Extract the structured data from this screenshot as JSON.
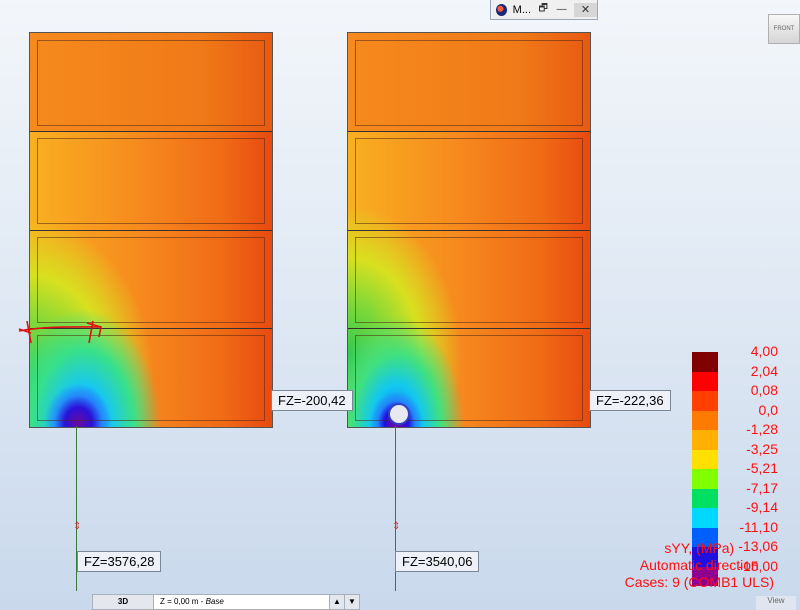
{
  "window": {
    "title": "M...",
    "controls": {
      "restore": "🗗",
      "minimize": "—",
      "close": "✕"
    }
  },
  "view_cube": {
    "face_label": "FRONT"
  },
  "reactions": {
    "left_support": "FZ=3576,28",
    "left_side": "FZ=-200,42",
    "right_support": "FZ=3540,06",
    "right_side": "FZ=-222,36"
  },
  "legend": {
    "entries": [
      {
        "value": "4,00",
        "color": "#800000"
      },
      {
        "value": "2,04",
        "color": "#ff0000"
      },
      {
        "value": "0,08",
        "color": "#ff4000"
      },
      {
        "value": "0,0",
        "color": "#ff7a00"
      },
      {
        "value": "-1,28",
        "color": "#ffb000"
      },
      {
        "value": "-3,25",
        "color": "#ffe000"
      },
      {
        "value": "-5,21",
        "color": "#80ff00"
      },
      {
        "value": "-7,17",
        "color": "#00e060"
      },
      {
        "value": "-9,14",
        "color": "#00d8ff"
      },
      {
        "value": "-11,10",
        "color": "#0060ff"
      },
      {
        "value": "-13,06",
        "color": "#2010e0"
      },
      {
        "value": "-15,00",
        "color": "#900090"
      }
    ],
    "caption_line1": "sYY, (MPa)",
    "caption_line2": "Automatic direction",
    "caption_line3": "Cases: 9 (COMB1 ULS)"
  },
  "statusbar": {
    "view_mode": "3D",
    "level_prefix": "Z = 0,00 m - ",
    "level_name": "Base",
    "view_button": "View"
  }
}
